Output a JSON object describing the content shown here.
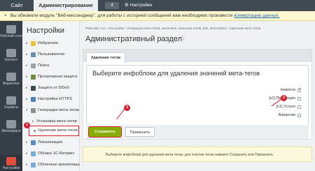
{
  "topbar": {
    "site_tab": "Сайт",
    "admin_tab": "Администрирование",
    "badge": "4",
    "settings_link": "Настройки"
  },
  "notice": {
    "close": "×",
    "text": "Вы обновили модуль \"Веб-мессенджер\". для работы с историей сообщений вам необходимо произвести",
    "link": "конвертацию данных."
  },
  "iconbar": [
    {
      "label": "Рабочий стол"
    },
    {
      "label": "Контент"
    },
    {
      "label": "Маркетинг"
    },
    {
      "label": "Сервисы"
    },
    {
      "label": "Marketplace"
    },
    {
      "label": "Настройки"
    }
  ],
  "sidebar": {
    "title": "Настройки",
    "items": [
      {
        "label": "Избранное"
      },
      {
        "label": "Пользователи"
      },
      {
        "label": "Поиск"
      },
      {
        "label": "Проактивная защита"
      },
      {
        "label": "Защита от DDoS"
      },
      {
        "label": "Настройка HTTPS"
      },
      {
        "label": "Генерация мета-тегов"
      },
      {
        "label": "Установка мета-тегов"
      },
      {
        "label": "Удаление мета-тегов"
      },
      {
        "label": "Локализация"
      },
      {
        "label": "Облако 1С-Битрикс"
      },
      {
        "label": "Облачные хранилища"
      }
    ]
  },
  "breadcrumb": "Рабочий стол  ›  Настройки  ›  Генерация мета-тегов: заголовок, описание (meta_title, description)  ›  Удаление мета-тегов",
  "page_title": "Административный раздел",
  "star": "☆",
  "tab": "Удаление тегов",
  "form": {
    "heading": "Выберите инфоблоки для удаления значений мета-тегов",
    "rows": [
      {
        "label": "Новости",
        "checked": true
      },
      {
        "label": "[к1] Продукция",
        "checked": false
      },
      {
        "label": "[c1] Услуги",
        "checked": false
      },
      {
        "label": "Вакансии",
        "checked": false
      }
    ],
    "save": "Сохранить",
    "apply": "Применить"
  },
  "hint": "Выберите инфоблоки для удаления мета-тегов, для очистки тегов нажмите Сохранить или Применить",
  "markers": {
    "m1": "1",
    "m2": "2",
    "m3": "3"
  },
  "colors": {
    "accent_red": "#d21d2f",
    "save_green": "#86ad00",
    "topbar": "#3f4a52"
  }
}
